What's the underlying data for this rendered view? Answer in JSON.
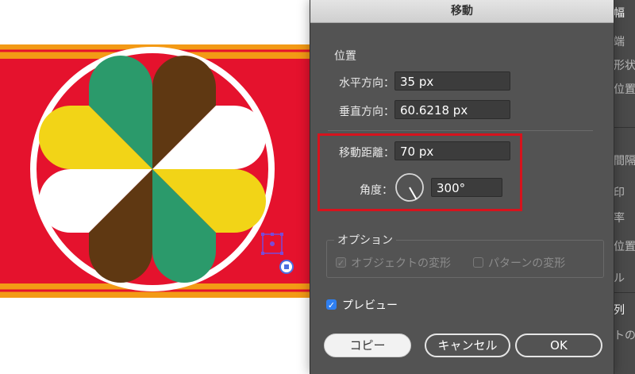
{
  "dialog": {
    "title": "移動",
    "position_section": "位置",
    "horizontal_label": "水平方向：",
    "horizontal_value": "35 px",
    "vertical_label": "垂直方向：",
    "vertical_value": "60.6218 px",
    "distance_label": "移動距離：",
    "distance_value": "70 px",
    "angle_label": "角度：",
    "angle_value": "300°",
    "options_section": "オプション",
    "transform_objects_label": "オブジェクトの変形",
    "transform_objects_checked": true,
    "transform_patterns_label": "パターンの変形",
    "transform_patterns_checked": false,
    "preview_label": "プレビュー",
    "preview_checked": true,
    "copy_button": "コピー",
    "cancel_button": "キャンセル",
    "ok_button": "OK"
  },
  "side_panel": {
    "items": [
      "幅",
      "端",
      "形状",
      "位置",
      "間隔",
      "印",
      "率",
      "位置",
      "ル",
      "列",
      "トの"
    ]
  },
  "colors": {
    "band_red": "#e5122d",
    "band_orange": "#f39a15",
    "green": "#2b9a6b",
    "brown": "#5f3812",
    "yellow": "#f2d417",
    "white": "#ffffff",
    "highlight_red": "#d7131d",
    "check_blue": "#2f7ff0"
  },
  "icons": {
    "selection": "selected-anchor-icon",
    "reference_point": "reference-point-icon",
    "angle_dial": "angle-dial-icon"
  }
}
